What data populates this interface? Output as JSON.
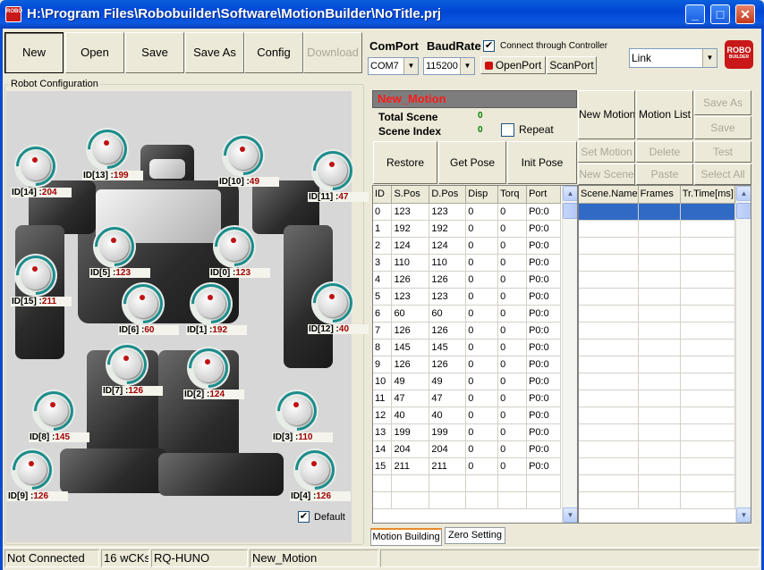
{
  "window": {
    "title": "H:\\Program Files\\Robobuilder\\Software\\MotionBuilder\\NoTitle.prj",
    "icon_text": "ROBO",
    "minimize_glyph": "_",
    "maximize_glyph": "□",
    "close_glyph": "✕"
  },
  "toolbar": {
    "new": "New",
    "open": "Open",
    "save": "Save",
    "save_as": "Save As",
    "config": "Config",
    "download": "Download"
  },
  "connection": {
    "comport_label": "ComPort",
    "baudrate_label": "BaudRate",
    "comport_value": "COM7",
    "baudrate_value": "115200",
    "connect_through_controller_label": "Connect through Controller",
    "connect_through_controller_checked": true,
    "open_port": "OpenPort",
    "scan_port": "ScanPort",
    "link_value": "Link"
  },
  "logo": {
    "line1": "ROBO",
    "line2": "BUILDER"
  },
  "robot_config": {
    "title": "Robot Configuration",
    "default_label": "Default",
    "default_checked": true,
    "servos": [
      {
        "id": "ID[14] :",
        "value": "204"
      },
      {
        "id": "ID[13] :",
        "value": "199"
      },
      {
        "id": "ID[10] :",
        "value": "49"
      },
      {
        "id": "ID[11] :",
        "value": "47"
      },
      {
        "id": "ID[5] :",
        "value": "123"
      },
      {
        "id": "ID[0] :",
        "value": "123"
      },
      {
        "id": "ID[15] :",
        "value": "211"
      },
      {
        "id": "ID[12] :",
        "value": "40"
      },
      {
        "id": "ID[6] :",
        "value": "60"
      },
      {
        "id": "ID[1] :",
        "value": "192"
      },
      {
        "id": "ID[7] :",
        "value": "126"
      },
      {
        "id": "ID[2] :",
        "value": "124"
      },
      {
        "id": "ID[8] :",
        "value": "145"
      },
      {
        "id": "ID[3] :",
        "value": "110"
      },
      {
        "id": "ID[9] :",
        "value": "126"
      },
      {
        "id": "ID[4] :",
        "value": "126"
      }
    ]
  },
  "motion": {
    "name": "New_Motion",
    "total_scene_label": "Total Scene",
    "total_scene_value": "0",
    "scene_index_label": "Scene Index",
    "scene_index_value": "0",
    "repeat_label": "Repeat",
    "restore": "Restore",
    "get_pose": "Get Pose",
    "init_pose": "Init Pose",
    "new_motion": "New Motion",
    "motion_list": "Motion List",
    "save_as": "Save As",
    "save": "Save",
    "set_motion": "Set Motion",
    "delete": "Delete",
    "test": "Test",
    "new_scene": "New Scene",
    "paste": "Paste",
    "select_all": "Select All"
  },
  "servo_table": {
    "columns": [
      "ID",
      "S.Pos",
      "D.Pos",
      "Disp",
      "Torq",
      "Port"
    ],
    "rows": [
      [
        "0",
        "123",
        "123",
        "0",
        "0",
        "P0:0"
      ],
      [
        "1",
        "192",
        "192",
        "0",
        "0",
        "P0:0"
      ],
      [
        "2",
        "124",
        "124",
        "0",
        "0",
        "P0:0"
      ],
      [
        "3",
        "110",
        "110",
        "0",
        "0",
        "P0:0"
      ],
      [
        "4",
        "126",
        "126",
        "0",
        "0",
        "P0:0"
      ],
      [
        "5",
        "123",
        "123",
        "0",
        "0",
        "P0:0"
      ],
      [
        "6",
        "60",
        "60",
        "0",
        "0",
        "P0:0"
      ],
      [
        "7",
        "126",
        "126",
        "0",
        "0",
        "P0:0"
      ],
      [
        "8",
        "145",
        "145",
        "0",
        "0",
        "P0:0"
      ],
      [
        "9",
        "126",
        "126",
        "0",
        "0",
        "P0:0"
      ],
      [
        "10",
        "49",
        "49",
        "0",
        "0",
        "P0:0"
      ],
      [
        "11",
        "47",
        "47",
        "0",
        "0",
        "P0:0"
      ],
      [
        "12",
        "40",
        "40",
        "0",
        "0",
        "P0:0"
      ],
      [
        "13",
        "199",
        "199",
        "0",
        "0",
        "P0:0"
      ],
      [
        "14",
        "204",
        "204",
        "0",
        "0",
        "P0:0"
      ],
      [
        "15",
        "211",
        "211",
        "0",
        "0",
        "P0:0"
      ]
    ]
  },
  "scene_table": {
    "columns": [
      "Scene.Name",
      "Frames",
      "Tr.Time[ms]"
    ]
  },
  "tabs": {
    "motion_building": "Motion Building",
    "zero_setting": "Zero Setting"
  },
  "status": {
    "connection": "Not Connected",
    "cks": "16 wCKs",
    "model": "RQ-HUNO",
    "motion": "New_Motion"
  }
}
